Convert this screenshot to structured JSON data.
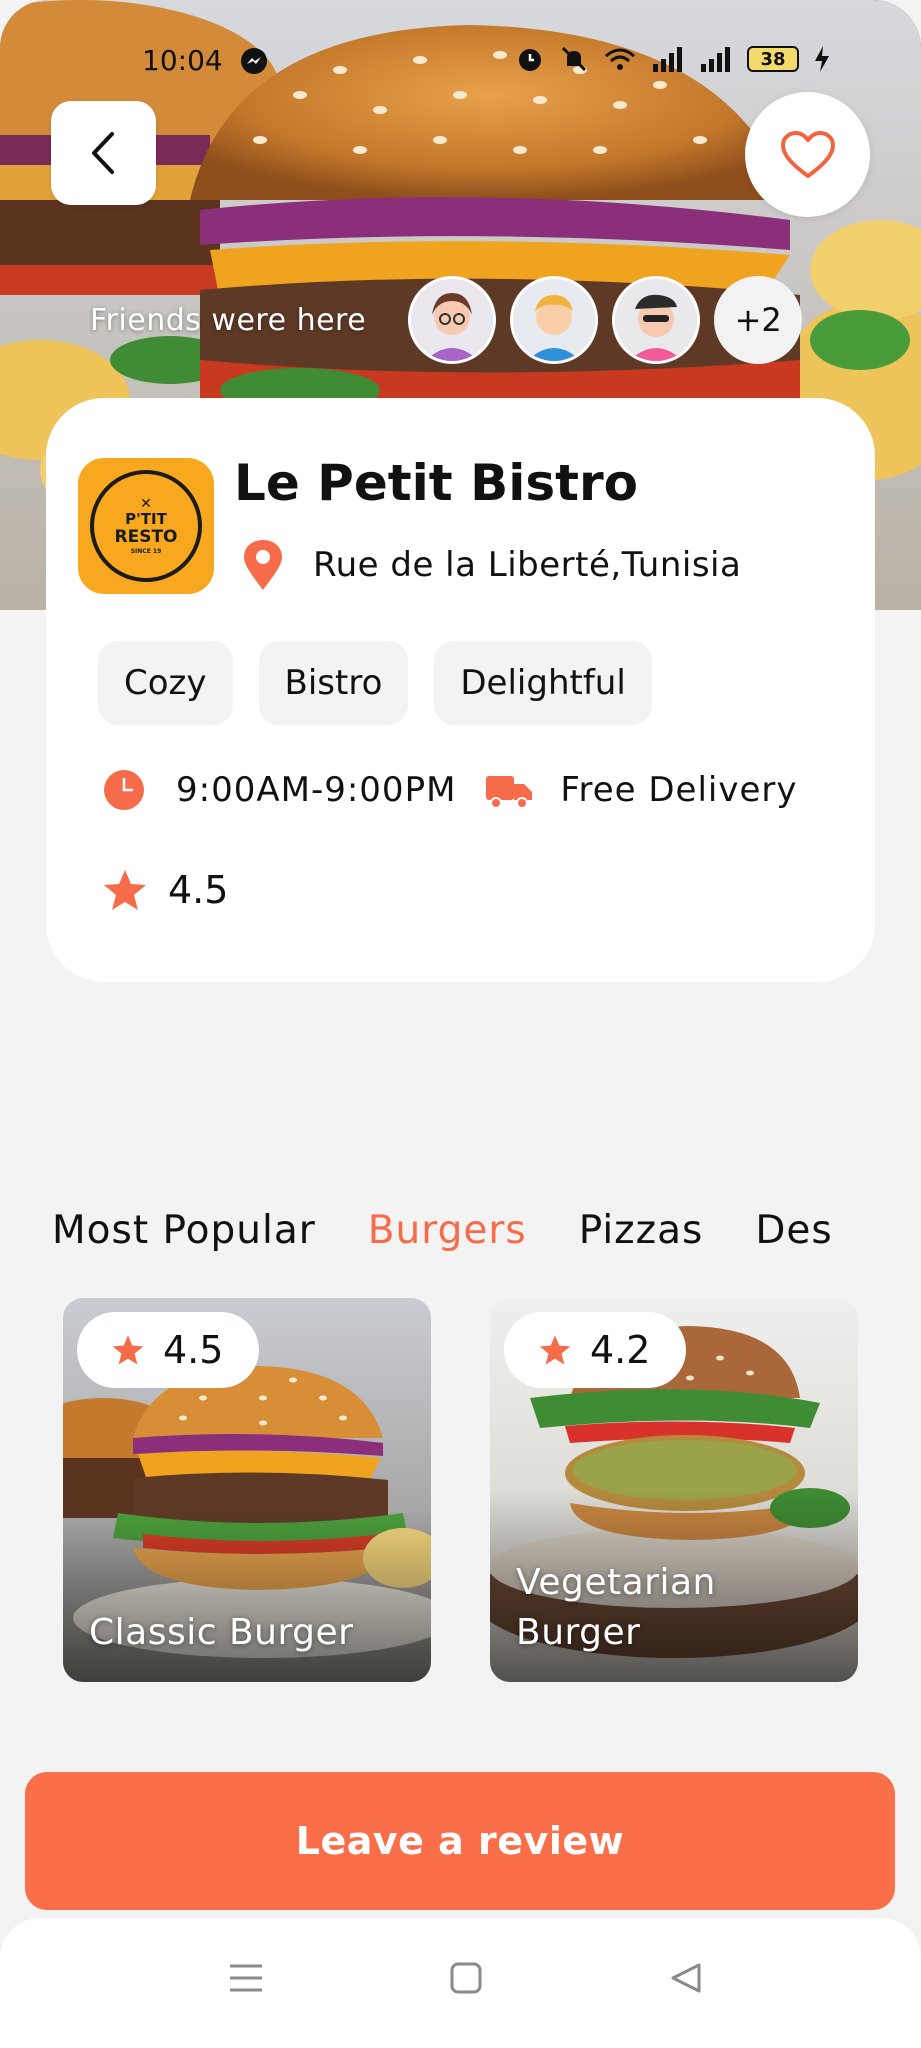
{
  "status_bar": {
    "time": "10:04",
    "battery": "38",
    "icons": [
      "messenger-icon",
      "alarm-icon",
      "mute-icon",
      "wifi-icon",
      "signal-icon",
      "signal-icon",
      "battery-icon",
      "charging-icon"
    ]
  },
  "hero": {
    "friends_label": "Friends were here",
    "more_friends": "+2"
  },
  "restaurant": {
    "logo_top": "P'TIT",
    "logo_mid": "RESTO",
    "logo_sub": "SINCE 19",
    "name": "Le Petit Bistro",
    "location": "Rue de la Liberté,Tunisia",
    "tags": [
      "Cozy",
      "Bistro",
      "Delightful"
    ],
    "hours": "9:00AM-9:00PM",
    "delivery": "Free Delivery",
    "rating": "4.5"
  },
  "tabs": [
    {
      "label": "Most Popular",
      "active": false
    },
    {
      "label": "Burgers",
      "active": true
    },
    {
      "label": "Pizzas",
      "active": false
    },
    {
      "label": "Des",
      "active": false
    }
  ],
  "dishes": [
    {
      "rating": "4.5",
      "name": "Classic Burger"
    },
    {
      "rating": "4.2",
      "name": "Vegetarian Burger"
    }
  ],
  "cta": {
    "label": "Leave a review"
  },
  "colors": {
    "accent": "#F66C4A",
    "button": "#FA6F4A",
    "logo_bg": "#F7A81E"
  }
}
